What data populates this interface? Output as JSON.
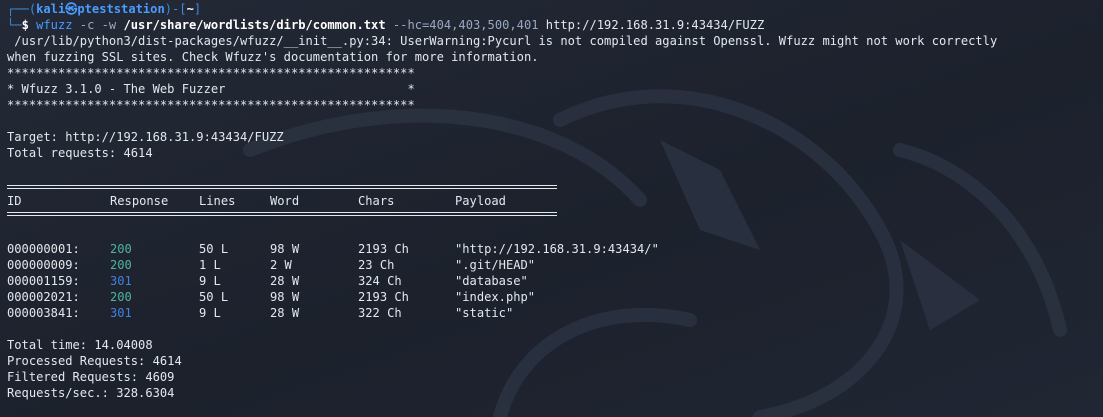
{
  "prompt": {
    "corner_top": "┌──(",
    "user": "kali",
    "at": "㉿",
    "host": "pteststation",
    "close": ")-[",
    "dir": "~",
    "end": "]",
    "corner_bottom": "└─",
    "symbol": "$ "
  },
  "command": {
    "program": "wfuzz",
    "flags": " -c -w ",
    "wordlist": "/usr/share/wordlists/dirb/common.txt",
    "hide_opt": " --hc=404,403,500,401",
    "url": " http://192.168.31.9:43434/FUZZ"
  },
  "warning": {
    "line1": " /usr/lib/python3/dist-packages/wfuzz/__init__.py:34: UserWarning:Pycurl is not compiled against Openssl. Wfuzz might not work correctly",
    "line2": "when fuzzing SSL sites. Check Wfuzz's documentation for more information."
  },
  "banner": {
    "stars": "********************************************************",
    "title": "* Wfuzz 3.1.0 - The Web Fuzzer                         *"
  },
  "target": {
    "target_line": "Target: http://192.168.31.9:43434/FUZZ",
    "total_line": "Total requests: 4614"
  },
  "table": {
    "headers": {
      "id": "ID",
      "response": "Response",
      "lines": "Lines",
      "word": "Word",
      "chars": "Chars",
      "payload": "Payload"
    },
    "rows": [
      {
        "id": "000000001:",
        "response": "200",
        "lines": "50 L",
        "word": "98 W",
        "chars": "2193 Ch",
        "payload": "\"http://192.168.31.9:43434/\""
      },
      {
        "id": "000000009:",
        "response": "200",
        "lines": "1 L",
        "word": "2 W",
        "chars": "23 Ch",
        "payload": "\".git/HEAD\""
      },
      {
        "id": "000001159:",
        "response": "301",
        "lines": "9 L",
        "word": "28 W",
        "chars": "324 Ch",
        "payload": "\"database\""
      },
      {
        "id": "000002021:",
        "response": "200",
        "lines": "50 L",
        "word": "98 W",
        "chars": "2193 Ch",
        "payload": "\"index.php\""
      },
      {
        "id": "000003841:",
        "response": "301",
        "lines": "9 L",
        "word": "28 W",
        "chars": "322 Ch",
        "payload": "\"static\""
      }
    ]
  },
  "summary": {
    "total_time": "Total time: 14.04008",
    "processed": "Processed Requests: 4614",
    "filtered": "Filtered Requests: 4609",
    "rate": "Requests/sec.: 328.6304"
  },
  "colors": {
    "background": "#1f2430",
    "text": "#e4e7ec",
    "prompt_blue": "#3c8cd8",
    "status_200": "#4fb3a3",
    "status_301": "#3f82e0"
  }
}
